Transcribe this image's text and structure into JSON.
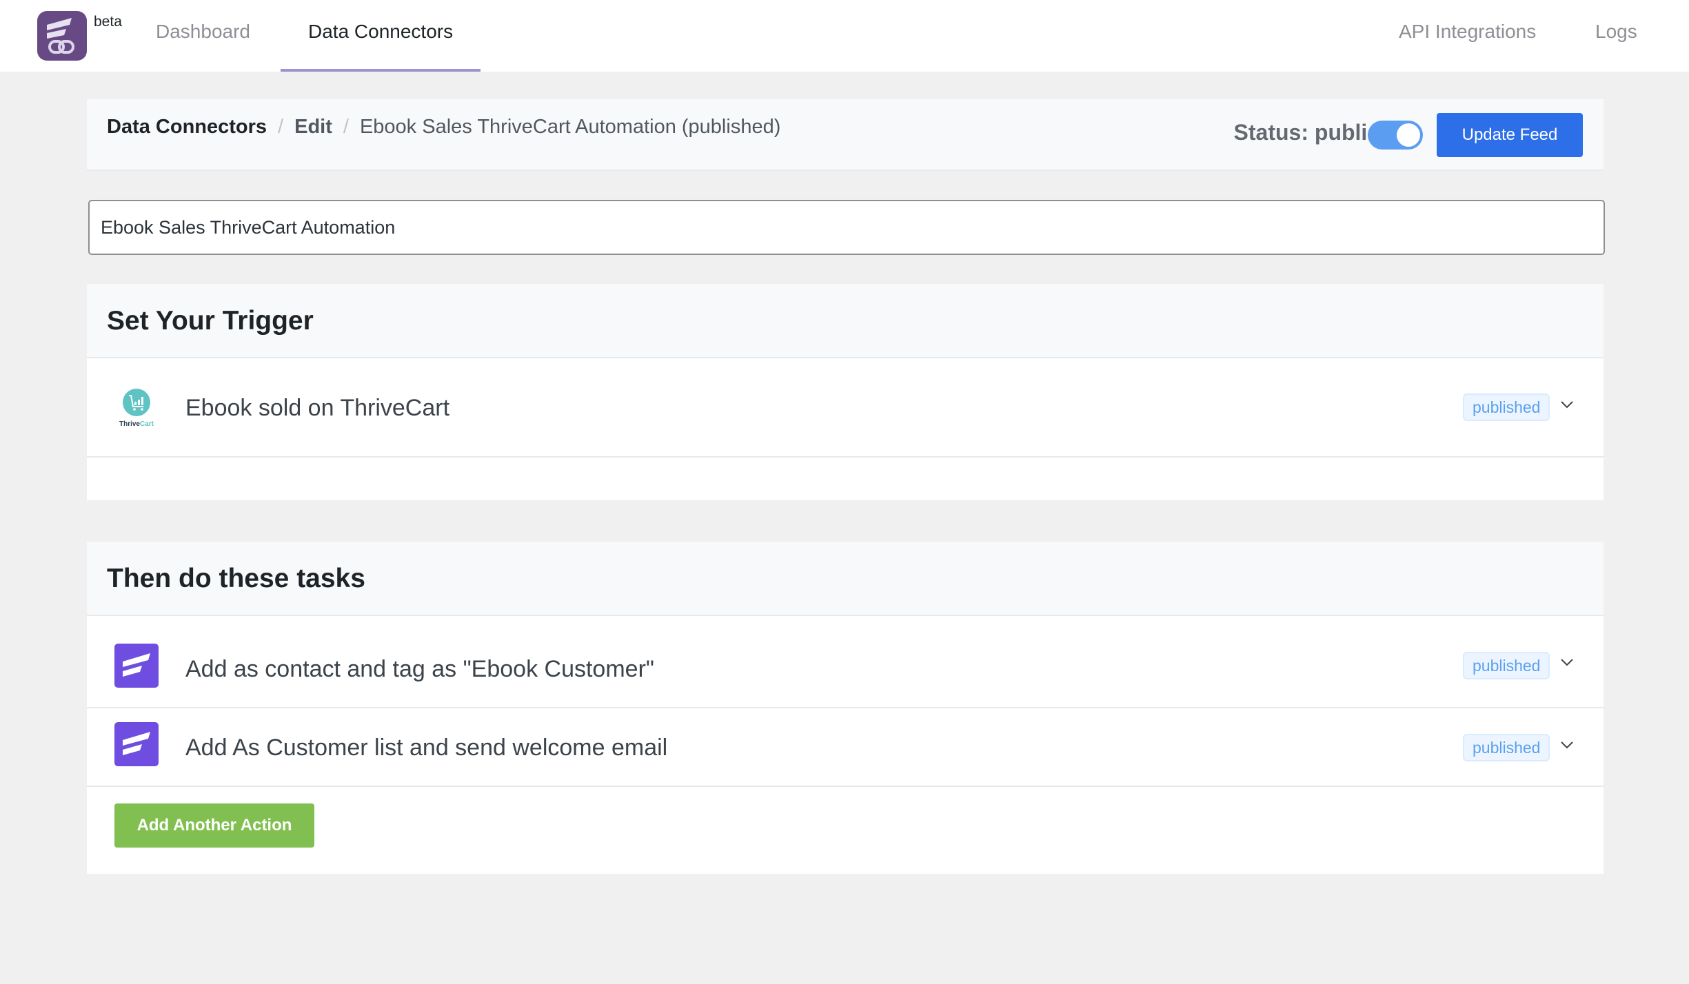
{
  "app": {
    "beta_label": "beta"
  },
  "nav": {
    "items": [
      {
        "label": "Dashboard",
        "active": false
      },
      {
        "label": "Data Connectors",
        "active": true
      },
      {
        "label": "API Integrations",
        "active": false
      },
      {
        "label": "Logs",
        "active": false
      }
    ]
  },
  "header": {
    "breadcrumb": {
      "root": "Data Connectors",
      "separator": "/",
      "edit": "Edit",
      "current": "Ebook Sales ThriveCart Automation (published)"
    },
    "status_text": "Status: published",
    "status_enabled": true,
    "update_button": "Update Feed"
  },
  "feed": {
    "title_value": "Ebook Sales ThriveCart Automation"
  },
  "trigger": {
    "heading": "Set Your Trigger",
    "item": {
      "icon": "thrivecart-logo-icon",
      "logo_text_dark": "Thrive",
      "logo_text_light": "Cart",
      "label": "Ebook sold on ThriveCart",
      "status": "published"
    }
  },
  "tasks": {
    "heading": "Then do these tasks",
    "items": [
      {
        "icon": "fluentcrm-logo-icon",
        "label": "Add as contact and tag as \"Ebook Customer\"",
        "status": "published"
      },
      {
        "icon": "fluentcrm-logo-icon",
        "label": "Add As Customer list and send welcome email",
        "status": "published"
      }
    ],
    "add_button": "Add Another Action"
  },
  "colors": {
    "primary_blue": "#2c6fe8",
    "toggle_on": "#5b9df1",
    "add_green": "#81bf50",
    "fluent_purple": "#6f4de0",
    "logo_purple": "#674a84",
    "badge_text": "#5ba0ee",
    "thrivecart_teal": "#5fc3c4"
  }
}
